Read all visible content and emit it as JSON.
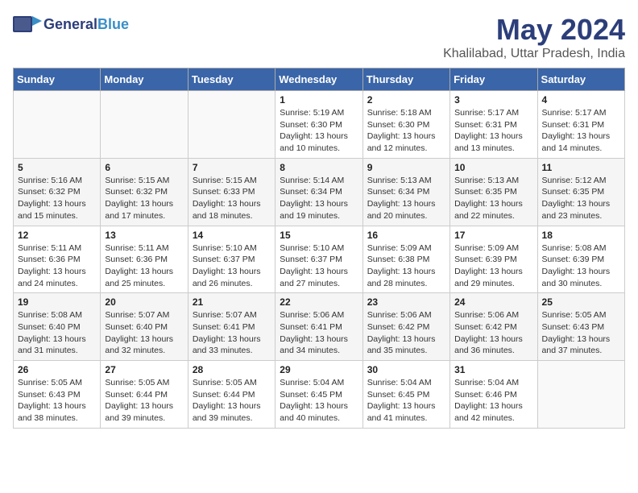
{
  "header": {
    "logo_general": "General",
    "logo_blue": "Blue",
    "month_title": "May 2024",
    "location": "Khalilabad, Uttar Pradesh, India"
  },
  "days_of_week": [
    "Sunday",
    "Monday",
    "Tuesday",
    "Wednesday",
    "Thursday",
    "Friday",
    "Saturday"
  ],
  "weeks": [
    [
      {
        "num": "",
        "sunrise": "",
        "sunset": "",
        "daylight": ""
      },
      {
        "num": "",
        "sunrise": "",
        "sunset": "",
        "daylight": ""
      },
      {
        "num": "",
        "sunrise": "",
        "sunset": "",
        "daylight": ""
      },
      {
        "num": "1",
        "sunrise": "Sunrise: 5:19 AM",
        "sunset": "Sunset: 6:30 PM",
        "daylight": "Daylight: 13 hours and 10 minutes."
      },
      {
        "num": "2",
        "sunrise": "Sunrise: 5:18 AM",
        "sunset": "Sunset: 6:30 PM",
        "daylight": "Daylight: 13 hours and 12 minutes."
      },
      {
        "num": "3",
        "sunrise": "Sunrise: 5:17 AM",
        "sunset": "Sunset: 6:31 PM",
        "daylight": "Daylight: 13 hours and 13 minutes."
      },
      {
        "num": "4",
        "sunrise": "Sunrise: 5:17 AM",
        "sunset": "Sunset: 6:31 PM",
        "daylight": "Daylight: 13 hours and 14 minutes."
      }
    ],
    [
      {
        "num": "5",
        "sunrise": "Sunrise: 5:16 AM",
        "sunset": "Sunset: 6:32 PM",
        "daylight": "Daylight: 13 hours and 15 minutes."
      },
      {
        "num": "6",
        "sunrise": "Sunrise: 5:15 AM",
        "sunset": "Sunset: 6:32 PM",
        "daylight": "Daylight: 13 hours and 17 minutes."
      },
      {
        "num": "7",
        "sunrise": "Sunrise: 5:15 AM",
        "sunset": "Sunset: 6:33 PM",
        "daylight": "Daylight: 13 hours and 18 minutes."
      },
      {
        "num": "8",
        "sunrise": "Sunrise: 5:14 AM",
        "sunset": "Sunset: 6:34 PM",
        "daylight": "Daylight: 13 hours and 19 minutes."
      },
      {
        "num": "9",
        "sunrise": "Sunrise: 5:13 AM",
        "sunset": "Sunset: 6:34 PM",
        "daylight": "Daylight: 13 hours and 20 minutes."
      },
      {
        "num": "10",
        "sunrise": "Sunrise: 5:13 AM",
        "sunset": "Sunset: 6:35 PM",
        "daylight": "Daylight: 13 hours and 22 minutes."
      },
      {
        "num": "11",
        "sunrise": "Sunrise: 5:12 AM",
        "sunset": "Sunset: 6:35 PM",
        "daylight": "Daylight: 13 hours and 23 minutes."
      }
    ],
    [
      {
        "num": "12",
        "sunrise": "Sunrise: 5:11 AM",
        "sunset": "Sunset: 6:36 PM",
        "daylight": "Daylight: 13 hours and 24 minutes."
      },
      {
        "num": "13",
        "sunrise": "Sunrise: 5:11 AM",
        "sunset": "Sunset: 6:36 PM",
        "daylight": "Daylight: 13 hours and 25 minutes."
      },
      {
        "num": "14",
        "sunrise": "Sunrise: 5:10 AM",
        "sunset": "Sunset: 6:37 PM",
        "daylight": "Daylight: 13 hours and 26 minutes."
      },
      {
        "num": "15",
        "sunrise": "Sunrise: 5:10 AM",
        "sunset": "Sunset: 6:37 PM",
        "daylight": "Daylight: 13 hours and 27 minutes."
      },
      {
        "num": "16",
        "sunrise": "Sunrise: 5:09 AM",
        "sunset": "Sunset: 6:38 PM",
        "daylight": "Daylight: 13 hours and 28 minutes."
      },
      {
        "num": "17",
        "sunrise": "Sunrise: 5:09 AM",
        "sunset": "Sunset: 6:39 PM",
        "daylight": "Daylight: 13 hours and 29 minutes."
      },
      {
        "num": "18",
        "sunrise": "Sunrise: 5:08 AM",
        "sunset": "Sunset: 6:39 PM",
        "daylight": "Daylight: 13 hours and 30 minutes."
      }
    ],
    [
      {
        "num": "19",
        "sunrise": "Sunrise: 5:08 AM",
        "sunset": "Sunset: 6:40 PM",
        "daylight": "Daylight: 13 hours and 31 minutes."
      },
      {
        "num": "20",
        "sunrise": "Sunrise: 5:07 AM",
        "sunset": "Sunset: 6:40 PM",
        "daylight": "Daylight: 13 hours and 32 minutes."
      },
      {
        "num": "21",
        "sunrise": "Sunrise: 5:07 AM",
        "sunset": "Sunset: 6:41 PM",
        "daylight": "Daylight: 13 hours and 33 minutes."
      },
      {
        "num": "22",
        "sunrise": "Sunrise: 5:06 AM",
        "sunset": "Sunset: 6:41 PM",
        "daylight": "Daylight: 13 hours and 34 minutes."
      },
      {
        "num": "23",
        "sunrise": "Sunrise: 5:06 AM",
        "sunset": "Sunset: 6:42 PM",
        "daylight": "Daylight: 13 hours and 35 minutes."
      },
      {
        "num": "24",
        "sunrise": "Sunrise: 5:06 AM",
        "sunset": "Sunset: 6:42 PM",
        "daylight": "Daylight: 13 hours and 36 minutes."
      },
      {
        "num": "25",
        "sunrise": "Sunrise: 5:05 AM",
        "sunset": "Sunset: 6:43 PM",
        "daylight": "Daylight: 13 hours and 37 minutes."
      }
    ],
    [
      {
        "num": "26",
        "sunrise": "Sunrise: 5:05 AM",
        "sunset": "Sunset: 6:43 PM",
        "daylight": "Daylight: 13 hours and 38 minutes."
      },
      {
        "num": "27",
        "sunrise": "Sunrise: 5:05 AM",
        "sunset": "Sunset: 6:44 PM",
        "daylight": "Daylight: 13 hours and 39 minutes."
      },
      {
        "num": "28",
        "sunrise": "Sunrise: 5:05 AM",
        "sunset": "Sunset: 6:44 PM",
        "daylight": "Daylight: 13 hours and 39 minutes."
      },
      {
        "num": "29",
        "sunrise": "Sunrise: 5:04 AM",
        "sunset": "Sunset: 6:45 PM",
        "daylight": "Daylight: 13 hours and 40 minutes."
      },
      {
        "num": "30",
        "sunrise": "Sunrise: 5:04 AM",
        "sunset": "Sunset: 6:45 PM",
        "daylight": "Daylight: 13 hours and 41 minutes."
      },
      {
        "num": "31",
        "sunrise": "Sunrise: 5:04 AM",
        "sunset": "Sunset: 6:46 PM",
        "daylight": "Daylight: 13 hours and 42 minutes."
      },
      {
        "num": "",
        "sunrise": "",
        "sunset": "",
        "daylight": ""
      }
    ]
  ]
}
